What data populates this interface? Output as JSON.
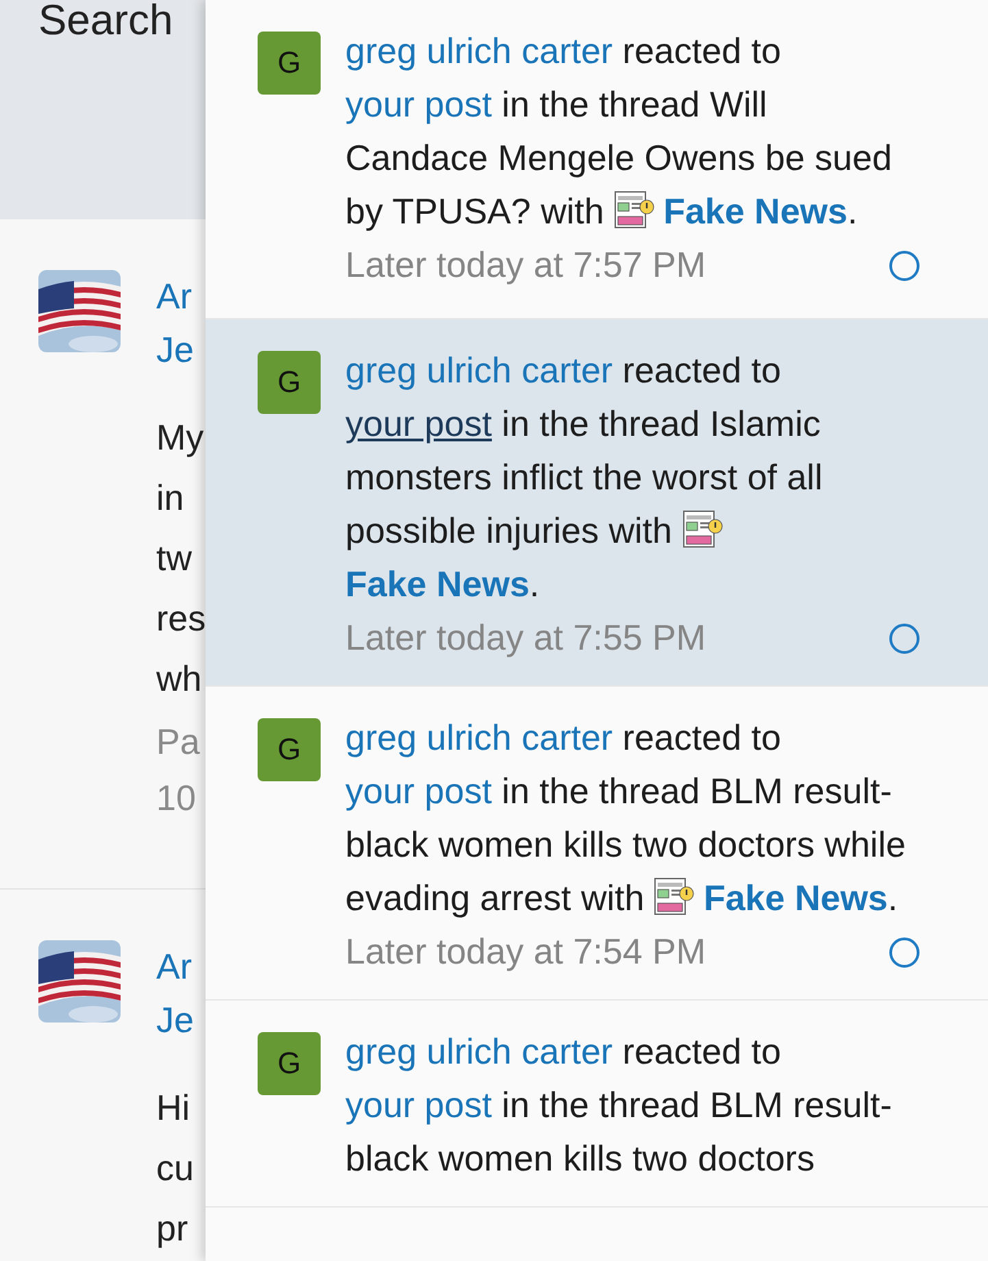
{
  "header": {
    "search_label": "Search"
  },
  "background_posts": [
    {
      "title_lines": [
        "Ar",
        "Je"
      ],
      "body_lines": [
        "My",
        "in",
        "tw",
        "res",
        "wh"
      ],
      "meta_lines": [
        "Pa",
        "10"
      ]
    },
    {
      "title_lines": [
        "Ar",
        "Je"
      ],
      "body_lines": [
        "Hi",
        "cu",
        "pr"
      ]
    }
  ],
  "notifications": [
    {
      "avatar_letter": "G",
      "user": "greg ulrich carter",
      "action": "reacted to",
      "link": "your post",
      "context": "in the thread Will Candace Mengele Owens be sued by TPUSA? with",
      "reaction": "Fake News",
      "end": ".",
      "time": "Later today at 7:57 PM",
      "selected": false
    },
    {
      "avatar_letter": "G",
      "user": "greg ulrich carter",
      "action": "reacted to",
      "link": "your post",
      "context": "in the thread Islamic monsters inflict the worst of all possible injuries with",
      "reaction": "Fake News",
      "end": ".",
      "time": "Later today at 7:55 PM",
      "selected": true
    },
    {
      "avatar_letter": "G",
      "user": "greg ulrich carter",
      "action": "reacted to",
      "link": "your post",
      "context": "in the thread BLM result-black women kills two doctors while evading arrest with",
      "reaction": "Fake News",
      "end": ".",
      "time": "Later today at 7:54 PM",
      "selected": false
    },
    {
      "avatar_letter": "G",
      "user": "greg ulrich carter",
      "action": "reacted to",
      "link": "your post",
      "context": "in the thread BLM result-black women kills two doctors",
      "selected": false
    }
  ]
}
